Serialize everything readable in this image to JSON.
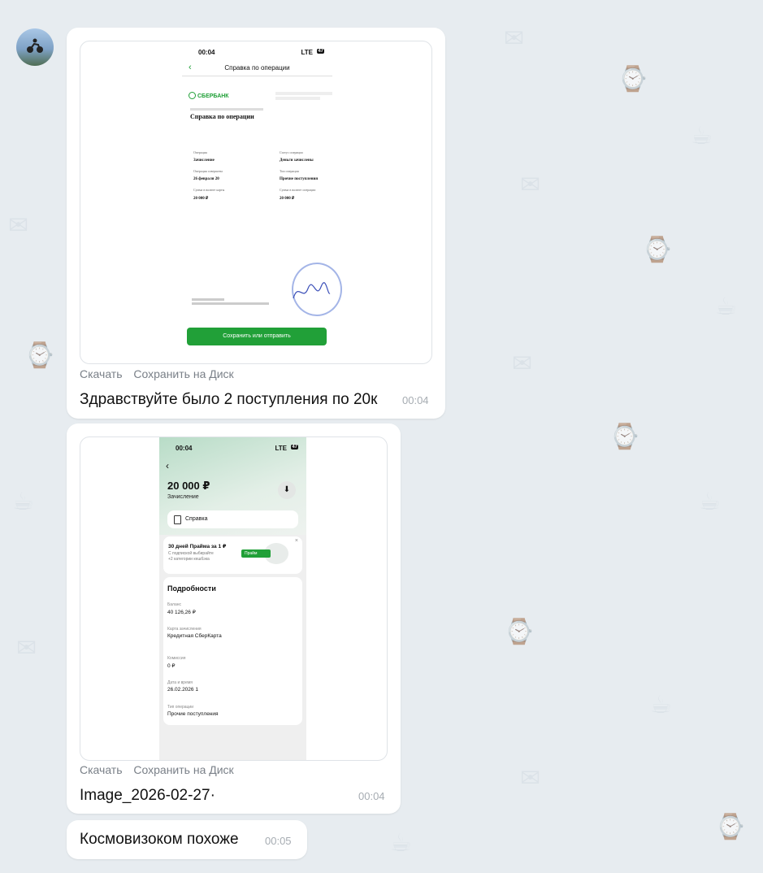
{
  "message1": {
    "document": {
      "status_time": "00:04",
      "status_right": "LTE",
      "battery": "47",
      "title": "Справка по операции",
      "bank_name": "СБЕРБАНК",
      "doc_heading": "Справка по операции",
      "fields": [
        {
          "label": "Операция",
          "value": "Зачисление"
        },
        {
          "label": "Статус операции",
          "value": "Деньги зачислены"
        },
        {
          "label": "Операция совершена",
          "value": "26 февраля 20"
        },
        {
          "label": "Тип операции",
          "value": "Прочие поступления"
        },
        {
          "label": "Сумма в валюте карты",
          "value": "20 000 ₽"
        },
        {
          "label": "Сумма в валюте операции",
          "value": "20 000 ₽"
        }
      ],
      "save_button": "Сохранить или отправить"
    },
    "download_label": "Скачать",
    "save_disk_label": "Сохранить на Диск",
    "text": "Здравствуйте было 2 поступления по 20к",
    "time": "00:04"
  },
  "message2": {
    "phone": {
      "status_time": "00:04",
      "status_right": "LTE",
      "battery": "47",
      "amount": "20 000 ₽",
      "subtitle": "Зачисление",
      "spravka_label": "Справка",
      "promo_title": "30 дней Прайма за 1 ₽",
      "promo_text_1": "С подпиской выбирайте",
      "promo_text_2": "+2 категории кешбэка",
      "promo_badge": "Прайм",
      "details_title": "Подробности",
      "details": [
        {
          "label": "Баланс",
          "value": "40 126,26 ₽"
        },
        {
          "label": "Карта зачисления",
          "value": "Кредитная СберКарта"
        },
        {
          "label": "Комиссия",
          "value": "0 ₽"
        },
        {
          "label": "Дата и время",
          "value": "26.02.2026 1"
        },
        {
          "label": "Тип операции",
          "value": "Прочие поступления"
        }
      ]
    },
    "download_label": "Скачать",
    "save_disk_label": "Сохранить на Диск",
    "filename": "Image_2026-02-27·",
    "time": "00:04"
  },
  "message3": {
    "text": "Космовизоком похоже",
    "time": "00:05"
  }
}
